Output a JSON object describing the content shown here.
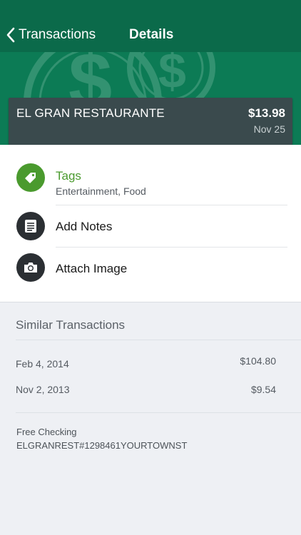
{
  "nav": {
    "back_label": "Transactions",
    "title": "Details"
  },
  "transaction": {
    "merchant": "EL GRAN RESTAURANTE",
    "amount": "$13.98",
    "date": "Nov 25"
  },
  "actions": {
    "tags": {
      "label": "Tags",
      "value": "Entertainment, Food",
      "icon": "tag-icon"
    },
    "notes": {
      "label": "Add Notes",
      "icon": "notes-icon"
    },
    "image": {
      "label": "Attach Image",
      "icon": "camera-icon"
    }
  },
  "similar": {
    "title": "Similar Transactions",
    "items": [
      {
        "date": "Feb 4, 2014",
        "amount": "$104.80"
      },
      {
        "date": "Nov 2, 2013",
        "amount": "$9.54"
      }
    ],
    "account_name": "Free Checking",
    "description": "ELGRANREST#1298461YOURTOWNST"
  },
  "colors": {
    "nav_bg": "#0b6a4a",
    "hero_bg": "#0c7b55",
    "card_bg": "#3a4a4d",
    "tag_green": "#4a9a2e",
    "icon_dark": "#2b2f33"
  }
}
